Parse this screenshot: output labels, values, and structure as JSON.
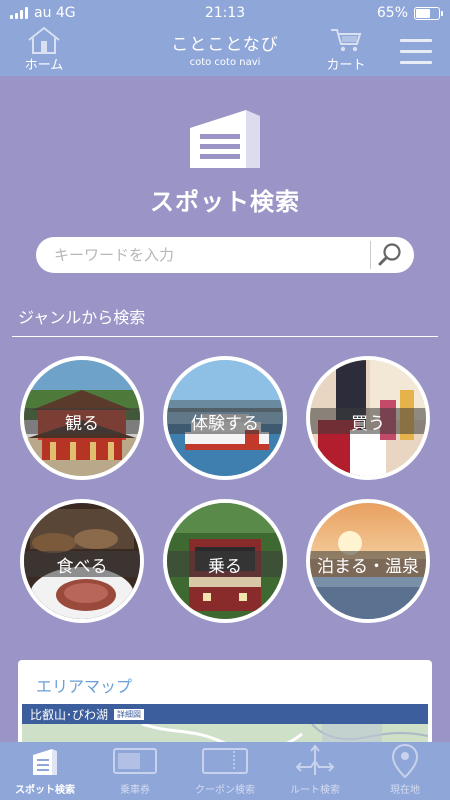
{
  "status_bar": {
    "carrier": "au 4G",
    "time": "21:13",
    "battery": "65%",
    "battery_level": 0.65
  },
  "header": {
    "home_label": "ホーム",
    "title": "ことことなび",
    "subtitle": "coto coto navi",
    "cart_label": "カート"
  },
  "main": {
    "title": "スポット検索",
    "search": {
      "placeholder": "キーワードを入力",
      "value": ""
    },
    "genre_heading": "ジャンルから検索",
    "genres": [
      {
        "label": "観る"
      },
      {
        "label": "体験する"
      },
      {
        "label": "買う"
      },
      {
        "label": "食べる"
      },
      {
        "label": "乗る"
      },
      {
        "label": "泊まる・温泉"
      }
    ],
    "area_map": {
      "title": "エリアマップ",
      "map_name": "比叡山･びわ湖",
      "map_badge": "詳細図"
    }
  },
  "tabbar": {
    "items": [
      {
        "label": "スポット検索",
        "active": true
      },
      {
        "label": "乗車券",
        "active": false
      },
      {
        "label": "クーポン検索",
        "active": false
      },
      {
        "label": "ルート検索",
        "active": false
      },
      {
        "label": "現在地",
        "active": false
      }
    ]
  },
  "colors": {
    "background": "#9a95c6",
    "bar": "#8fa6d8",
    "accent": "#6aa0d4"
  }
}
